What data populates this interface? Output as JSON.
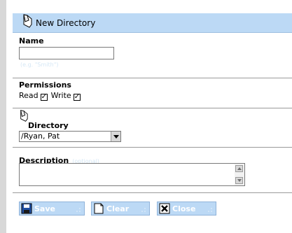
{
  "dialog": {
    "title": "New Directory"
  },
  "name_section": {
    "label": "Name",
    "value": "",
    "placeholder": "",
    "hint": "(e.g. \"Smith\")"
  },
  "permissions": {
    "label": "Permissions",
    "read_label": "Read",
    "read_checked": true,
    "write_label": "Write",
    "write_checked": true
  },
  "directory": {
    "label": "Directory",
    "selected": "/Ryan, Pat"
  },
  "description": {
    "label": "Description",
    "hint": "(optional)",
    "value": ""
  },
  "toolbar": {
    "save_label": "Save",
    "clear_label": "Clear",
    "close_label": "Close"
  },
  "colors": {
    "accent": "#bcd9f5",
    "button_border": "#8fb3da",
    "text": "#000000"
  },
  "icons": {
    "title": "folder-tab-icon",
    "directory": "folder-tab-icon",
    "save": "floppy-disk-icon",
    "clear": "blank-page-icon",
    "close": "x-close-icon"
  }
}
